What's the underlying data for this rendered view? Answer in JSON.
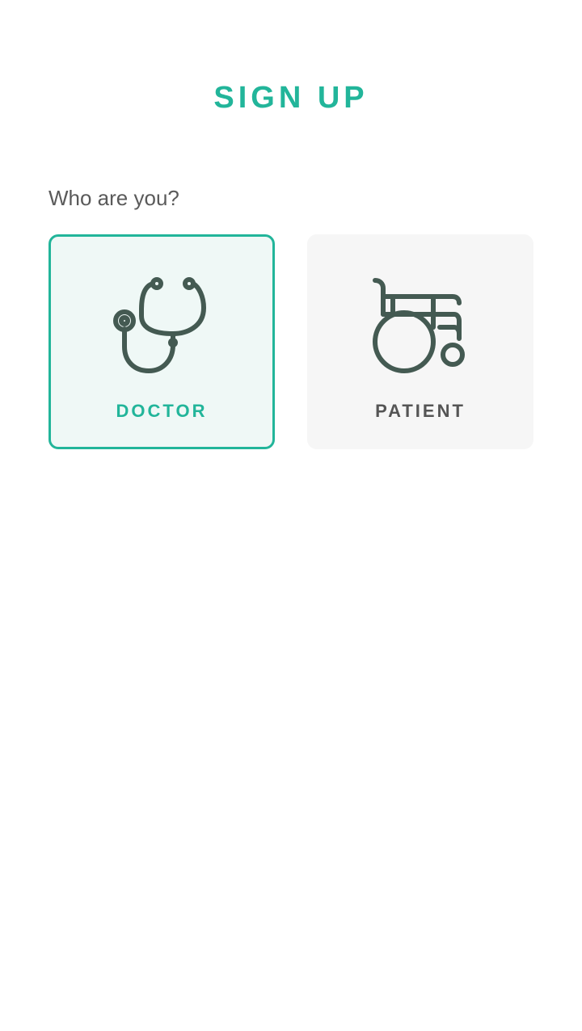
{
  "header": {
    "title": "SIGN UP"
  },
  "form": {
    "question": "Who are you?",
    "selected": "doctor",
    "options": [
      {
        "id": "doctor",
        "label": "DOCTOR",
        "icon": "stethoscope-icon"
      },
      {
        "id": "patient",
        "label": "PATIENT",
        "icon": "wheelchair-icon"
      }
    ]
  },
  "colors": {
    "accent": "#22b59a",
    "icon": "#445a52",
    "selected_bg": "#eff8f6",
    "unselected_bg": "#f6f6f6",
    "text": "#5a5a5a"
  }
}
